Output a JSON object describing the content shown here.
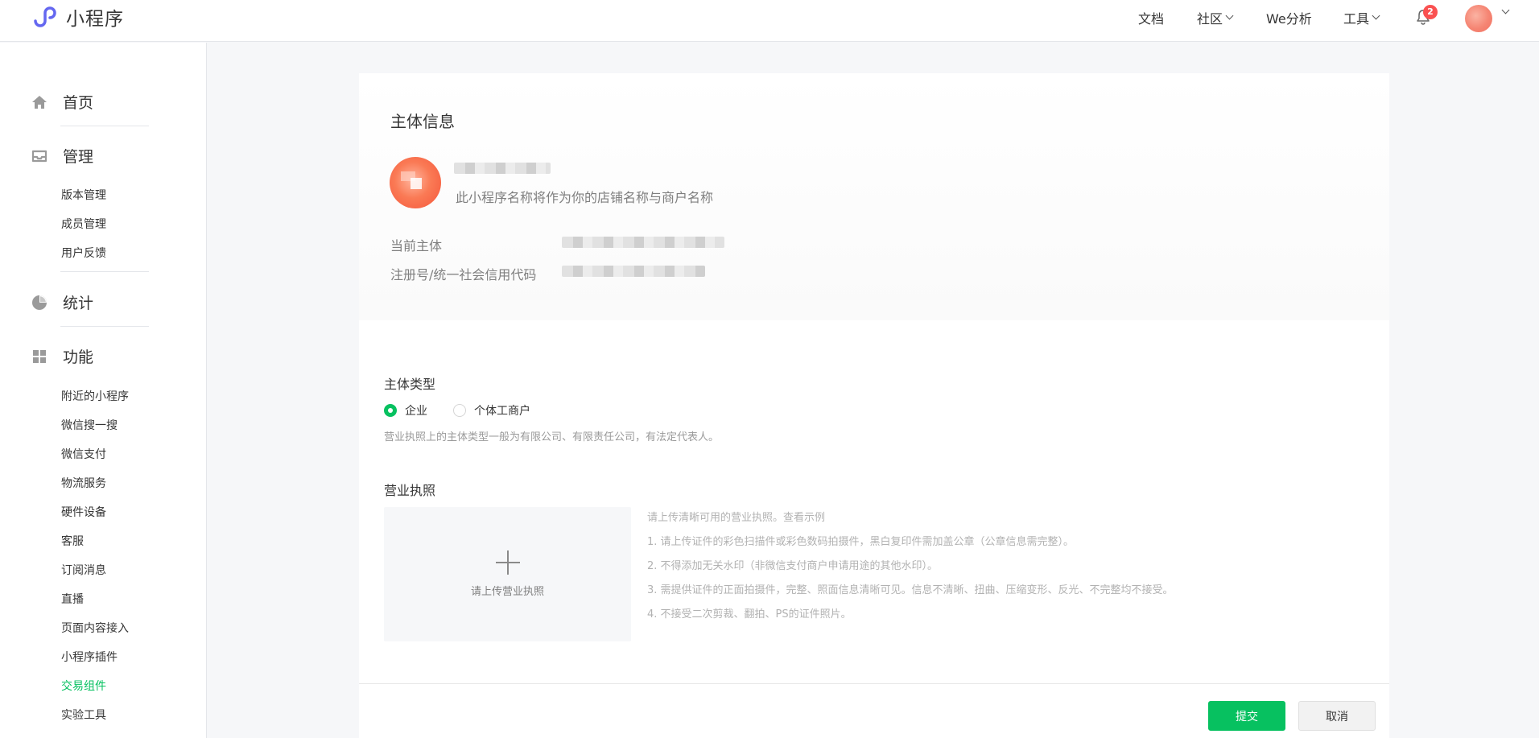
{
  "brand": {
    "name": "小程序",
    "logo_icon": "mini-program-logo-icon",
    "accent": "#07c160",
    "logo_color": "#6467f0"
  },
  "header": {
    "nav": [
      {
        "label": "文档",
        "has_caret": false
      },
      {
        "label": "社区",
        "has_caret": true
      },
      {
        "label": "We分析",
        "has_caret": false
      },
      {
        "label": "工具",
        "has_caret": true
      }
    ],
    "notification_count": "2"
  },
  "sidebar": {
    "sections": [
      {
        "label": "首页",
        "icon": "home-icon",
        "items": []
      },
      {
        "label": "管理",
        "icon": "inbox-icon",
        "items": [
          "版本管理",
          "成员管理",
          "用户反馈"
        ]
      },
      {
        "label": "统计",
        "icon": "pie-chart-icon",
        "items": []
      },
      {
        "label": "功能",
        "icon": "grid-icon",
        "items": [
          "附近的小程序",
          "微信搜一搜",
          "微信支付",
          "物流服务",
          "硬件设备",
          "客服",
          "订阅消息",
          "直播",
          "页面内容接入",
          "小程序插件",
          "交易组件",
          "实验工具"
        ]
      }
    ],
    "active_item": "交易组件"
  },
  "subject_info": {
    "title": "主体信息",
    "name_hint": "此小程序名称将作为你的店铺名称与商户名称",
    "rows": [
      {
        "label": "当前主体"
      },
      {
        "label": "注册号/统一社会信用代码"
      }
    ]
  },
  "form": {
    "subject_type": {
      "label": "主体类型",
      "options": [
        "企业",
        "个体工商户"
      ],
      "selected": "企业",
      "hint": "营业执照上的主体类型一般为有限公司、有限责任公司，有法定代表人。"
    },
    "license": {
      "label": "营业执照",
      "upload_label": "请上传营业执照",
      "requirements_intro": "请上传清晰可用的营业执照。",
      "example_link": "查看示例",
      "requirements": [
        "1. 请上传证件的彩色扫描件或彩色数码拍摄件，黑白复印件需加盖公章（公章信息需完整）。",
        "2. 不得添加无关水印（非微信支付商户申请用途的其他水印）。",
        "3. 需提供证件的正面拍摄件，完整、照面信息清晰可见。信息不清晰、扭曲、压缩变形、反光、不完整均不接受。",
        "4. 不接受二次剪裁、翻拍、PS的证件照片。"
      ]
    }
  },
  "actions": {
    "submit": "提交",
    "cancel": "取消"
  }
}
